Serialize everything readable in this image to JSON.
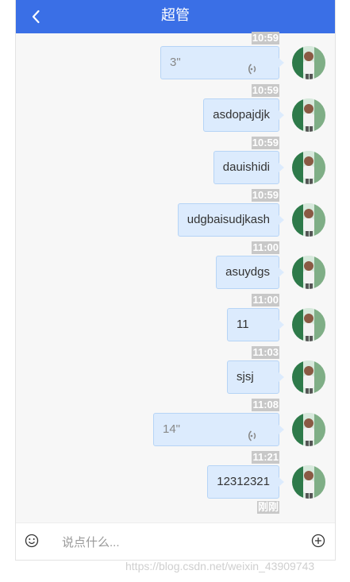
{
  "header": {
    "title": "超管",
    "back_icon": "chevron-left-icon"
  },
  "messages": [
    {
      "time": "10:59",
      "type": "voice",
      "text": "3\""
    },
    {
      "time": "10:59",
      "type": "text",
      "text": "asdopajdjk"
    },
    {
      "time": "10:59",
      "type": "text",
      "text": "dauishidi"
    },
    {
      "time": "10:59",
      "type": "text",
      "text": "udgbaisudjkash"
    },
    {
      "time": "11:00",
      "type": "text",
      "text": "asuydgs"
    },
    {
      "time": "11:00",
      "type": "text",
      "text": "11"
    },
    {
      "time": "11:03",
      "type": "text",
      "text": "sjsj"
    },
    {
      "time": "11:08",
      "type": "voice",
      "text": "14\""
    },
    {
      "time": "11:21",
      "type": "text",
      "text": "12312321"
    }
  ],
  "last_time": "刚刚",
  "input": {
    "placeholder": "说点什么...",
    "value": ""
  },
  "icons": {
    "emoji": "emoji-icon",
    "add": "plus-circle-icon",
    "voice": "voice-wave-icon"
  },
  "watermark": "https://blog.csdn.net/weixin_43909743",
  "colors": {
    "header": "#3a6fe6",
    "bubble": "#dcebfd",
    "bubble_border": "#b6d4f6",
    "timestamp": "#c8c8c8"
  }
}
